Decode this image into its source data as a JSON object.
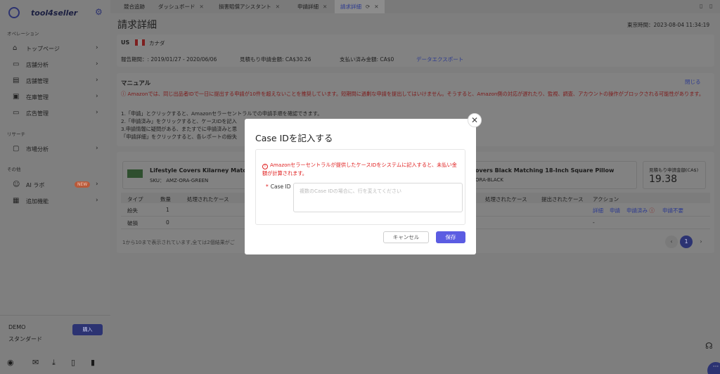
{
  "app": {
    "name": "tool4seller"
  },
  "sidebar": {
    "sections": [
      {
        "title": "オペレーション"
      },
      {
        "title": "リサーチ"
      },
      {
        "title": "その他"
      }
    ],
    "items": [
      {
        "label": "トップページ",
        "icon": "home-icon"
      },
      {
        "label": "店舗分析",
        "icon": "chart-monitor-icon"
      },
      {
        "label": "店舗管理",
        "icon": "store-icon"
      },
      {
        "label": "在庫管理",
        "icon": "inventory-icon"
      },
      {
        "label": "広告管理",
        "icon": "monitor-icon"
      },
      {
        "label": "市場分析",
        "icon": "market-icon"
      },
      {
        "label": "AI ラボ",
        "icon": "robot-icon",
        "badge": "NEW"
      },
      {
        "label": "追加機能",
        "icon": "grid-icon"
      }
    ],
    "account": {
      "name": "DEMO",
      "plan": "スタンダード",
      "buy_label": "購入"
    }
  },
  "tabs": [
    {
      "label": "競合追跡"
    },
    {
      "label": "ダッシュボード"
    },
    {
      "label": "損害賠償アシスタント"
    },
    {
      "label": "申請詳細"
    },
    {
      "label": "請求詳細",
      "active": true
    }
  ],
  "header": {
    "title": "請求詳細",
    "tokyo_time": "東京時間：2023-08-04 11:34:19"
  },
  "info": {
    "marketplace": "US",
    "country": "カナダ",
    "period": "報告期間：: 2019/01/27 - 2020/06/06",
    "estimate": "見積もり申請金額: CA$30.26",
    "paid": "支払い済み金額: CA$0",
    "export": "データエクスポート"
  },
  "manual": {
    "title": "マニュアル",
    "collapse": "閉じる",
    "warning": "Amazonでは、同じ出品者IDで一日に提出する申請が10件を超えないことを推奨しています。短期間に過剰な申請を提出してはいけません。そうすると、Amazon側の対応が遅れたり、監視、調査、アカウントの操作がブロックされる可能性があります。",
    "steps": [
      "1.「申請」とクリックすると、Amazonセラーセントラルでの申請手順を確認できます。",
      "2.「申請済み」をクリックすると、ケースIDを記入",
      "3.申請情報に疑問がある、またすでに申請済みと思",
      "「申請詳細」をクリックすると、各レポートの紛失"
    ]
  },
  "claims": {
    "products": [
      {
        "title": "Lifestyle Covers Kilarney Matching",
        "sku": "SKU： AMZ-ORA-GREEN"
      },
      {
        "title": "overs Black Matching 18-Inch Square Pillow",
        "sku": "ORA-BLACK"
      }
    ],
    "estimate_label": "見積もり申請金額(CA$)",
    "estimate_value": "19.38",
    "headers_left": [
      "タイプ",
      "数量",
      "処理されたケース"
    ],
    "headers_right": [
      "処理されたケース",
      "提出されたケース",
      "アクション"
    ],
    "rows": [
      {
        "type": "紛失",
        "qty": "1"
      },
      {
        "type": "破損",
        "qty": "0"
      }
    ],
    "actions": [
      "詳細",
      "申請",
      "申請済み",
      "申請不要"
    ],
    "dash": "-",
    "footer": "1から10まで表示されています,全ては2個結果がご",
    "page": "1"
  },
  "modal": {
    "title": "Case IDを記入する",
    "alert": "Amazonセラーセントラルが提供したケースIDをシステムに記入すると、未払い金額が計算されます。",
    "field_label": "Case ID",
    "required_mark": "*",
    "placeholder": "複数のCase IDの場合に、行を変えてください",
    "cancel": "キャンセル",
    "save": "保存"
  }
}
